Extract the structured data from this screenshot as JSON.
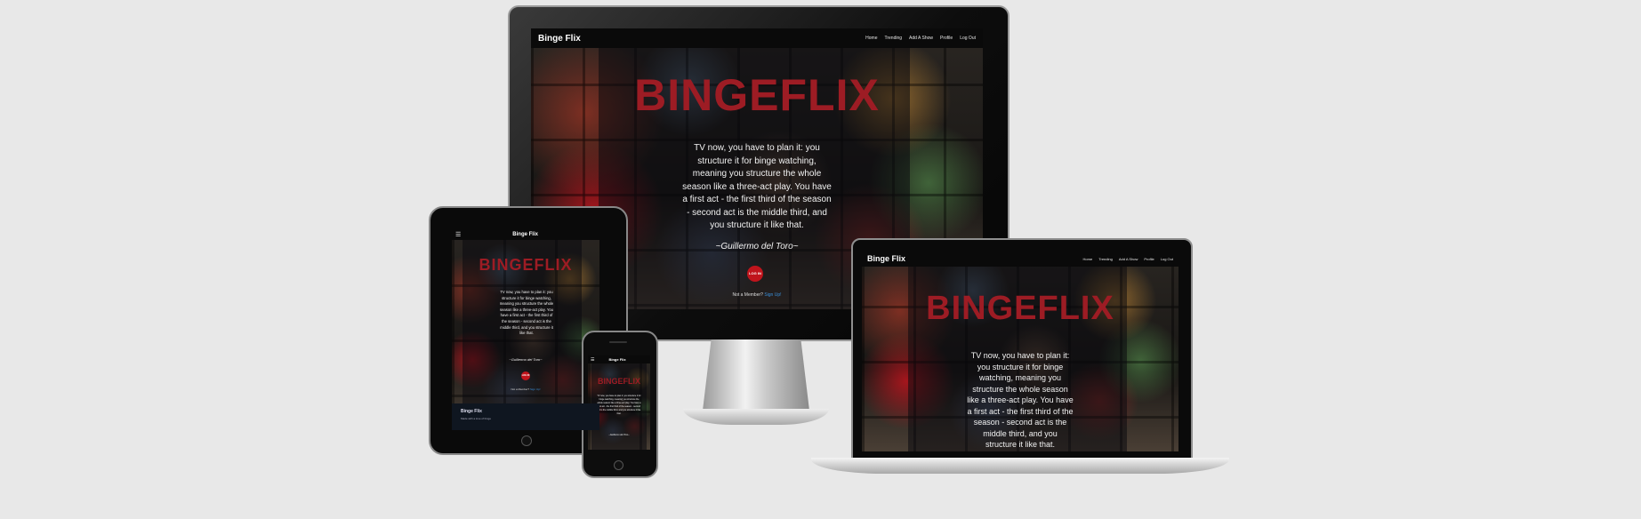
{
  "app": {
    "brand": "Binge Flix",
    "nav": [
      "Home",
      "Trending",
      "Add A Show",
      "Profile",
      "Log Out"
    ],
    "hero_title": "BINGEFLIX",
    "quote_desktop": "TV now, you have to plan it: you structure it for binge watching, meaning you structure the whole season like a three-act play. You have a first act - the first third of the season - second act is the middle third, and you structure it like that.",
    "quote_laptop": "TV now, you have to plan it: you structure it for binge watching, meaning you structure the whole season like a three-act play. You have a first act - the first third of the season - second act is the middle third, and you structure it like that.",
    "author": "~Guillermo del Toro~",
    "login_label": "LOG IN",
    "signup_text": "Not a Member?",
    "signup_link": "Sign Up!",
    "footer_title": "Binge Flix",
    "footer_text": "Made with a love of binge",
    "menu_icon": "hamburger-icon"
  },
  "colors": {
    "background": "#e8e8e8",
    "accent": "#9d1c24",
    "button": "#c0141c",
    "navbar": "#0a0a0a"
  }
}
